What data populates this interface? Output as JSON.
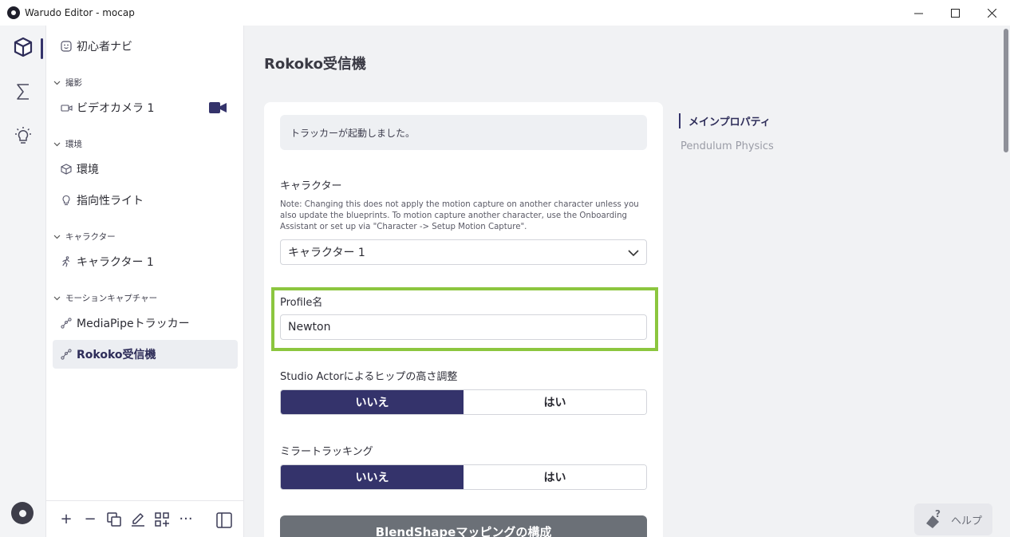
{
  "window": {
    "title": "Warudo Editor - mocap",
    "minimize": "—",
    "maximize": "☐",
    "close": "✕"
  },
  "sidebar": {
    "onboarding_label": "初心者ナビ",
    "sections": [
      {
        "title": "撮影",
        "items": [
          {
            "label": "ビデオカメラ 1",
            "icon": "video-camera-icon"
          }
        ]
      },
      {
        "title": "環境",
        "items": [
          {
            "label": "環境",
            "icon": "cube-icon"
          },
          {
            "label": "指向性ライト",
            "icon": "lightbulb-icon"
          }
        ]
      },
      {
        "title": "キャラクター",
        "items": [
          {
            "label": "キャラクター 1",
            "icon": "running-figure-icon"
          }
        ]
      },
      {
        "title": "モーションキャプチャー",
        "items": [
          {
            "label": "MediaPipeトラッカー",
            "icon": "node-link-icon"
          },
          {
            "label": "Rokoko受信機",
            "icon": "node-link-icon",
            "selected": true
          }
        ]
      }
    ],
    "toolbar": {
      "add": "+",
      "remove": "−",
      "more": "···"
    }
  },
  "main": {
    "page_title": "Rokoko受信機",
    "notice": "トラッカーが起動しました。",
    "character": {
      "label": "キャラクター",
      "note": "Note: Changing this does not apply the motion capture on another character unless you also update the blueprints. To motion capture another character, use the Onboarding Assistant or set up via \"Character -> Setup Motion Capture\".",
      "value": "キャラクター 1"
    },
    "profile": {
      "label": "Profile名",
      "value": "Newton"
    },
    "hip_adjust": {
      "label": "Studio Actorによるヒップの高さ調整",
      "options": [
        "いいえ",
        "はい"
      ],
      "selected": 0
    },
    "mirror": {
      "label": "ミラートラッキング",
      "options": [
        "いいえ",
        "はい"
      ],
      "selected": 0
    },
    "blendshape_button": "BlendShapeマッピングの構成",
    "toc": [
      {
        "label": "メインプロパティ",
        "active": true
      },
      {
        "label": "Pendulum Physics",
        "active": false
      }
    ],
    "help_label": "ヘルプ"
  },
  "colors": {
    "accent": "#34336b",
    "highlight": "#8cc63f",
    "button_gray": "#6b7077"
  }
}
